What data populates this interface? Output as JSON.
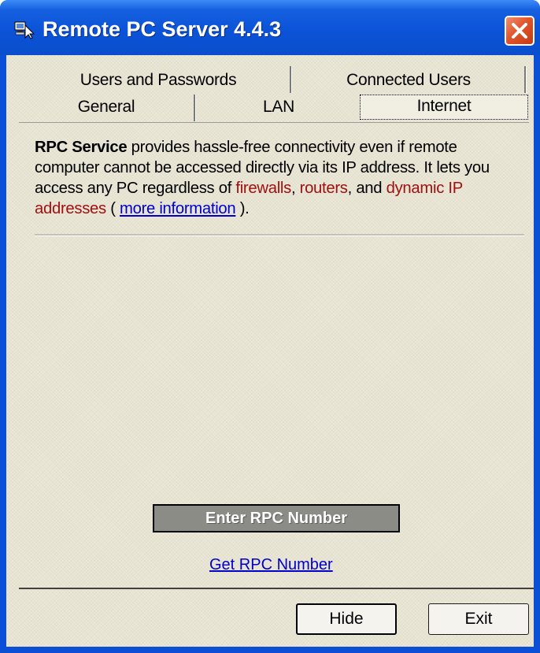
{
  "window": {
    "title": "Remote PC Server 4.4.3",
    "close_icon": "close-icon",
    "app_icon": "remote-pc-app-icon"
  },
  "tabs": {
    "row_back": [
      {
        "label": "Users and Passwords"
      },
      {
        "label": "Connected Users"
      }
    ],
    "row_front": [
      {
        "label": "General"
      },
      {
        "label": "LAN"
      },
      {
        "label": "Internet",
        "active": true
      }
    ]
  },
  "panel": {
    "description": {
      "heading": "RPC Service",
      "text1": " provides hassle-free connectivity even if remote computer cannot be accessed directly via its IP address. It lets you access any PC regardless of ",
      "firewalls": "firewalls",
      "comma1": ", ",
      "routers": "routers",
      "and": ", and ",
      "dynamic_ip": "dynamic IP addresses",
      "paren_open": " ( ",
      "link": "more information",
      "paren_close": " )."
    },
    "enter_button": "Enter RPC Number",
    "get_link": "Get RPC Number"
  },
  "footer": {
    "hide": "Hide",
    "exit": "Exit"
  },
  "colors": {
    "titlebar": "#0a4ecb",
    "face": "#ece9d8",
    "link": "#0000cc",
    "highlight_red": "#a01010",
    "close_button": "#e2552c"
  }
}
